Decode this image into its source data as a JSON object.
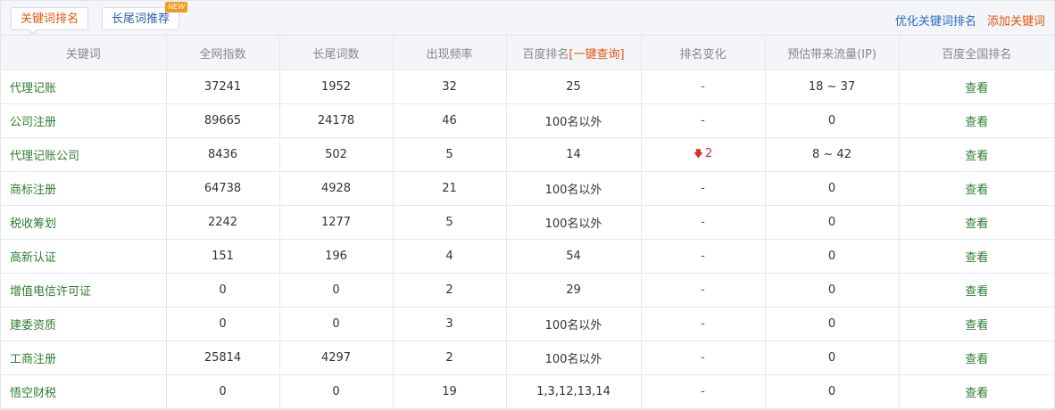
{
  "tabs": {
    "keyword_rank": "关键词排名",
    "longtail": "长尾词推荐",
    "new_badge": "NEW"
  },
  "top_links": {
    "optimize": "优化关键词排名",
    "add": "添加关键词"
  },
  "table": {
    "headers": {
      "keyword": "关键词",
      "index": "全网指数",
      "longtail": "长尾词数",
      "freq": "出现频率",
      "baidu_rank": "百度排名",
      "one_click": "[一键查询]",
      "change": "排名变化",
      "traffic": "预估带来流量(IP)",
      "national": "百度全国排名"
    },
    "rows": [
      {
        "keyword": "代理记账",
        "index": "37241",
        "longtail": "1952",
        "freq": "32",
        "rank": "25",
        "change": "-",
        "traffic": "18 ~ 37",
        "view": "查看"
      },
      {
        "keyword": "公司注册",
        "index": "89665",
        "longtail": "24178",
        "freq": "46",
        "rank": "100名以外",
        "change": "-",
        "traffic": "0",
        "view": "查看"
      },
      {
        "keyword": "代理记账公司",
        "index": "8436",
        "longtail": "502",
        "freq": "5",
        "rank": "14",
        "change": "2",
        "traffic": "8 ~ 42",
        "view": "查看"
      },
      {
        "keyword": "商标注册",
        "index": "64738",
        "longtail": "4928",
        "freq": "21",
        "rank": "100名以外",
        "change": "-",
        "traffic": "0",
        "view": "查看"
      },
      {
        "keyword": "税收筹划",
        "index": "2242",
        "longtail": "1277",
        "freq": "5",
        "rank": "100名以外",
        "change": "-",
        "traffic": "0",
        "view": "查看"
      },
      {
        "keyword": "高新认证",
        "index": "151",
        "longtail": "196",
        "freq": "4",
        "rank": "54",
        "change": "-",
        "traffic": "0",
        "view": "查看"
      },
      {
        "keyword": "增值电信许可证",
        "index": "0",
        "longtail": "0",
        "freq": "2",
        "rank": "29",
        "change": "-",
        "traffic": "0",
        "view": "查看"
      },
      {
        "keyword": "建委资质",
        "index": "0",
        "longtail": "0",
        "freq": "3",
        "rank": "100名以外",
        "change": "-",
        "traffic": "0",
        "view": "查看"
      },
      {
        "keyword": "工商注册",
        "index": "25814",
        "longtail": "4297",
        "freq": "2",
        "rank": "100名以外",
        "change": "-",
        "traffic": "0",
        "view": "查看"
      },
      {
        "keyword": "悟空财税",
        "index": "0",
        "longtail": "0",
        "freq": "19",
        "rank": "1,3,12,13,14",
        "change": "-",
        "traffic": "0",
        "view": "查看"
      }
    ]
  },
  "icons": {
    "down_arrow": "arrow-down-icon"
  },
  "colors": {
    "accent_orange": "#e8530b",
    "link_blue": "#2a6cc8",
    "keyword_green": "#2e7d32",
    "down_red": "#d32f2f"
  }
}
